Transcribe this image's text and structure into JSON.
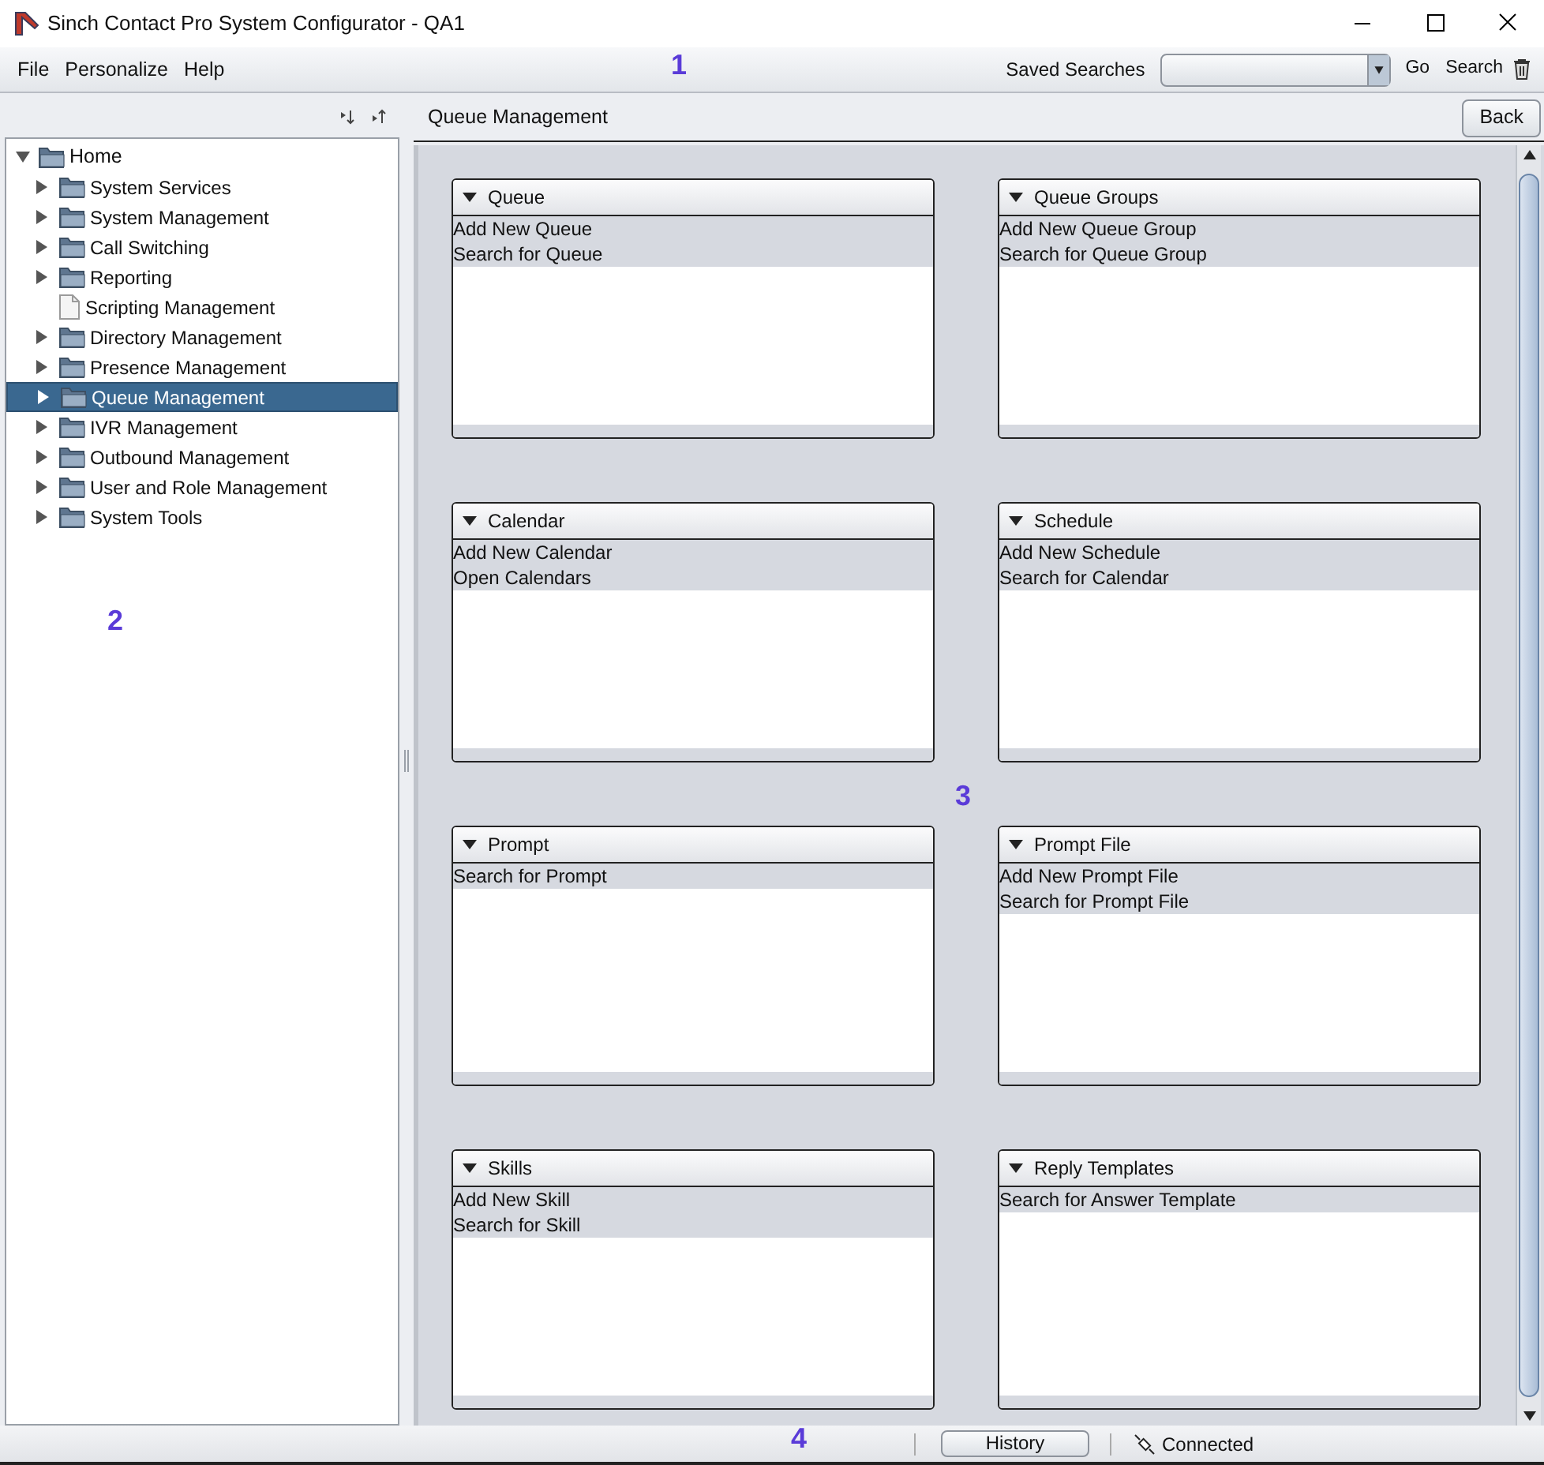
{
  "window": {
    "title": "Sinch Contact Pro System Configurator - QA1"
  },
  "menu": [
    "File",
    "Personalize",
    "Help"
  ],
  "search_bar": {
    "label": "Saved Searches",
    "go": "Go",
    "search": "Search"
  },
  "tree": {
    "label": "Home",
    "expanded": true,
    "children": [
      {
        "label": "System Services",
        "kind": "folder",
        "selected": false
      },
      {
        "label": "System Management",
        "kind": "folder",
        "selected": false
      },
      {
        "label": "Call Switching",
        "kind": "folder",
        "selected": false
      },
      {
        "label": "Reporting",
        "kind": "folder",
        "selected": false
      },
      {
        "label": "Scripting Management",
        "kind": "page",
        "selected": false
      },
      {
        "label": "Directory Management",
        "kind": "folder",
        "selected": false
      },
      {
        "label": "Presence Management",
        "kind": "folder",
        "selected": false
      },
      {
        "label": "Queue Management",
        "kind": "folder",
        "selected": true
      },
      {
        "label": "IVR Management",
        "kind": "folder",
        "selected": false
      },
      {
        "label": "Outbound Management",
        "kind": "folder",
        "selected": false
      },
      {
        "label": "User and Role Management",
        "kind": "folder",
        "selected": false
      },
      {
        "label": "System Tools",
        "kind": "folder",
        "selected": false
      }
    ]
  },
  "panel": {
    "title": "Queue Management",
    "back": "Back"
  },
  "cards": [
    {
      "title": "Queue",
      "items": [
        "Add New Queue",
        "Search for Queue"
      ]
    },
    {
      "title": "Queue Groups",
      "items": [
        "Add New Queue Group",
        "Search for Queue Group"
      ]
    },
    {
      "title": "Calendar",
      "items": [
        "Add New Calendar",
        "Open Calendars"
      ]
    },
    {
      "title": "Schedule",
      "items": [
        "Add New Schedule",
        "Search for Calendar"
      ]
    },
    {
      "title": "Prompt",
      "items": [
        "Search for Prompt"
      ]
    },
    {
      "title": "Prompt File",
      "items": [
        "Add New Prompt File",
        "Search for Prompt File"
      ]
    },
    {
      "title": "Skills",
      "items": [
        "Add New Skill",
        "Search for Skill"
      ]
    },
    {
      "title": "Reply Templates",
      "items": [
        "Search for Answer Template"
      ]
    }
  ],
  "status_bar": {
    "history": "History",
    "connection": "Connected"
  },
  "callouts": [
    "1",
    "2",
    "3",
    "4"
  ]
}
